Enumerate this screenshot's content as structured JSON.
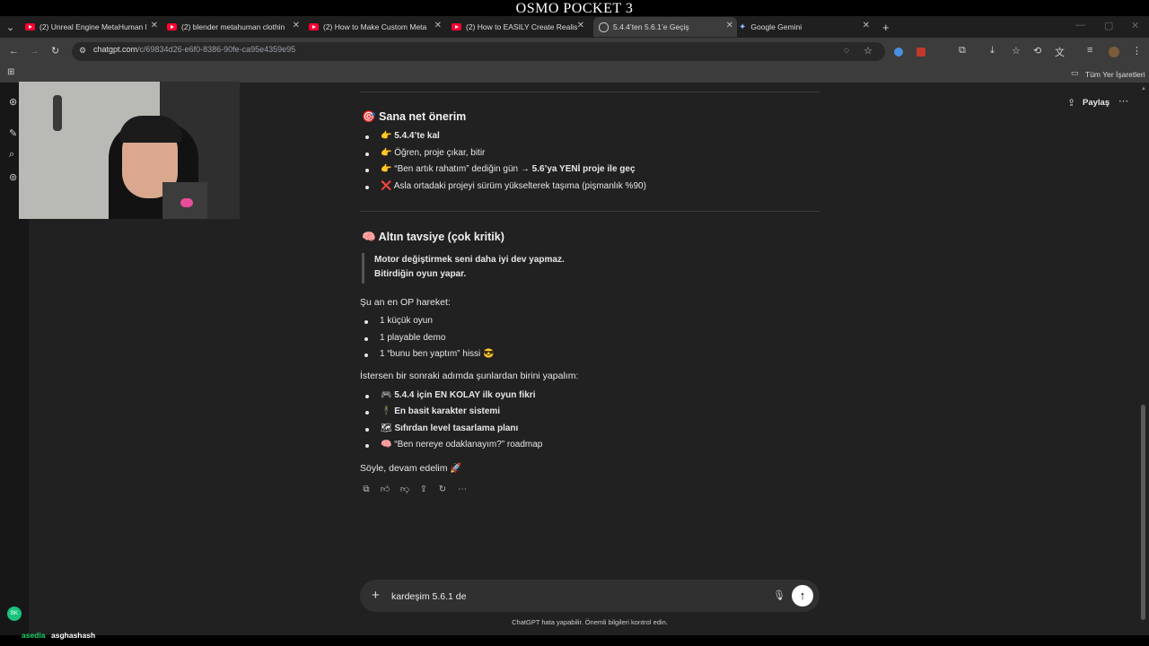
{
  "overlay": {
    "title": "OSMO POCKET 3"
  },
  "tabs": [
    {
      "label": "(2) Unreal Engine MetaHuman l",
      "icon": "youtube-icon"
    },
    {
      "label": "(2) blender metahuman clothin",
      "icon": "youtube-icon"
    },
    {
      "label": "(2) How to Make Custom Meta",
      "icon": "youtube-icon"
    },
    {
      "label": "(2) How to EASILY Create Realis",
      "icon": "youtube-icon"
    },
    {
      "label": "5.4.4’ten 5.6.1’e Geçiş",
      "icon": "chatgpt-icon",
      "active": true
    },
    {
      "label": "Google Gemini",
      "icon": "gemini-icon"
    }
  ],
  "address": {
    "host": "chatgpt.com",
    "path": "/c/69834d26-e6f0-8386-90fe-ca95e4359e95"
  },
  "bookmarks": {
    "all_label": "Tüm Yer İşaretleri"
  },
  "header": {
    "share_label": "Paylaş"
  },
  "sections": {
    "advice": {
      "heading": "🎯 Sana net önerim",
      "items": [
        {
          "emoji": "👉",
          "strong": "5.4.4’te kal"
        },
        {
          "emoji": "👉",
          "text": "Öğren, proje çıkar, bitir"
        },
        {
          "emoji": "👉",
          "text": "“Ben artık rahatım” dediğin gün → ",
          "strong": "5.6’ya YENİ proje ile geç"
        },
        {
          "emoji": "❌",
          "text": "Asla ortadaki projeyi sürüm yükselterek taşıma (pişmanlık %90)"
        }
      ]
    },
    "golden": {
      "heading": "🧠 Altın tavsiye (çok kritik)",
      "quote_line1": "Motor değiştirmek seni daha iyi dev yapmaz.",
      "quote_line2": "Bitirdiğin oyun yapar.",
      "intro": "Şu an en OP hareket:",
      "items": [
        "1 küçük oyun",
        "1 playable demo",
        "1 “bunu ben yaptım” hissi 😎"
      ],
      "next_intro": "İstersen bir sonraki adımda şunlardan birini yapalım:",
      "next_items": [
        {
          "emoji": "🎮",
          "strong": "5.4.4 için EN KOLAY ilk oyun fikri"
        },
        {
          "emoji": "🕴",
          "strong": "En basit karakter sistemi"
        },
        {
          "emoji": "🗺",
          "strong": "Sıfırdan level tasarlama planı"
        },
        {
          "emoji": "🧠",
          "text": "“Ben nereye odaklanayım?” roadmap"
        }
      ],
      "closing": "Söyle, devam edelim 🚀"
    }
  },
  "composer": {
    "value": "kardeşim 5.6.1 de"
  },
  "footer": {
    "note": "ChatGPT hata yapabilir. Önemli bilgileri kontrol edin."
  },
  "avatar": {
    "initials": "BK"
  },
  "stream_overlay": {
    "user1": "asedia",
    "user2": "asghashash"
  }
}
